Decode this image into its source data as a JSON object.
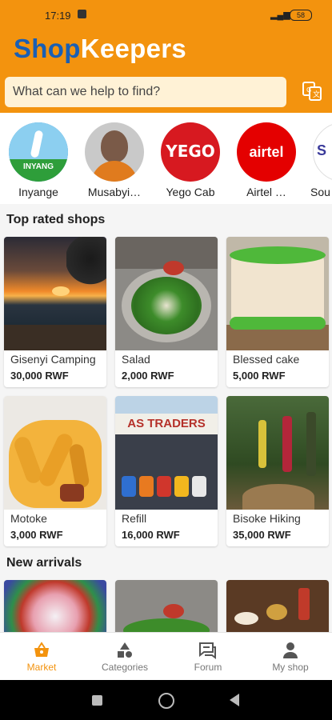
{
  "status_bar": {
    "time": "17:19",
    "battery": "58"
  },
  "header": {
    "logo_shop": "Shop",
    "logo_keepers": "Keepers",
    "search_placeholder": "What can we help to find?",
    "translate_icon": "translate-icon"
  },
  "stories": [
    {
      "label": "Inyange",
      "badge": "INYANG"
    },
    {
      "label": "Musabyi…",
      "badge": ""
    },
    {
      "label": "Yego Cab",
      "badge": "YEGO"
    },
    {
      "label": "Airtel …",
      "badge": "airtel"
    },
    {
      "label": "Sou",
      "badge": "S"
    }
  ],
  "sections": {
    "top_rated": "Top rated shops",
    "new_arrivals": "New arrivals"
  },
  "top_rated_items": [
    {
      "name": "Gisenyi Camping",
      "price": "30,000 RWF"
    },
    {
      "name": "Salad",
      "price": "2,000 RWF"
    },
    {
      "name": "Blessed cake",
      "price": "5,000 RWF"
    },
    {
      "name": "Motoke",
      "price": "3,000 RWF"
    },
    {
      "name": "Refill",
      "price": "16,000 RWF",
      "sign": "AS TRADERS"
    },
    {
      "name": "Bisoke Hiking",
      "price": "35,000 RWF"
    }
  ],
  "bottom_nav": [
    {
      "label": "Market",
      "icon": "basket-icon",
      "active": true
    },
    {
      "label": "Categories",
      "icon": "shapes-icon",
      "active": false
    },
    {
      "label": "Forum",
      "icon": "chat-icon",
      "active": false
    },
    {
      "label": "My shop",
      "icon": "person-icon",
      "active": false
    }
  ],
  "colors": {
    "accent": "#f3930e",
    "brand_blue": "#1a5fb4"
  }
}
